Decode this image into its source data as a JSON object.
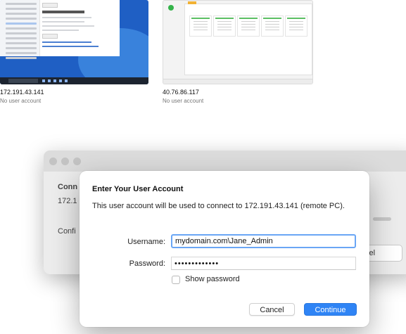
{
  "computers": [
    {
      "ip": "172.191.43.141",
      "account_status": "No user account"
    },
    {
      "ip": "40.76.86.117",
      "account_status": "No user account"
    }
  ],
  "background_window": {
    "title_partial": "Conn",
    "ip_partial": "172.1",
    "status_partial": "Confi",
    "cancel_partial": "cel"
  },
  "dialog": {
    "title": "Enter Your User Account",
    "message": "This user account will be used to connect to 172.191.43.141 (remote PC).",
    "username_label": "Username:",
    "username_value": "mydomain.com\\Jane_Admin",
    "password_label": "Password:",
    "password_value": "•••••••••••••",
    "show_password_label": "Show password",
    "cancel_label": "Cancel",
    "continue_label": "Continue"
  },
  "colors": {
    "accent": "#2f84f5",
    "focus_ring": "#6aa6f5",
    "status_dot": "#34b34a",
    "windows_desktop": "#1f5fc4"
  }
}
